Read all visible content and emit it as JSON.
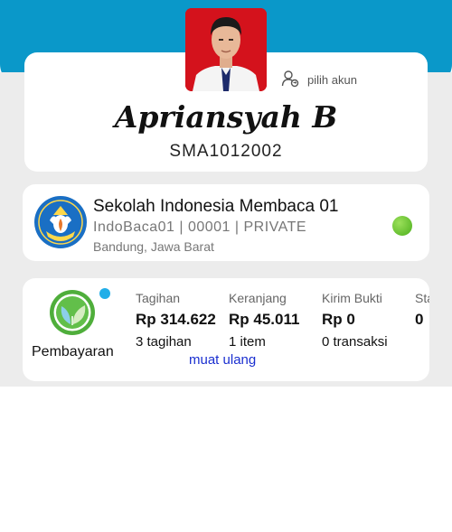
{
  "profile": {
    "name": "Apriansyah B",
    "student_code": "SMA1012002",
    "switch_account_label": "pilih akun"
  },
  "school": {
    "name": "Sekolah Indonesia Membaca 01",
    "meta": "IndoBaca01  |  00001  |  PRIVATE",
    "location": "Bandung, Jawa Barat",
    "status_color": "#5cc22a"
  },
  "payment": {
    "label": "Pembayaran",
    "reload_label": "muat ulang",
    "columns": [
      {
        "label": "Tagihan",
        "value": "Rp 314.622",
        "sub": "3 tagihan"
      },
      {
        "label": "Keranjang",
        "value": "Rp 45.011",
        "sub": "1 item"
      },
      {
        "label": "Kirim Bukti",
        "value": "Rp 0",
        "sub": "0 transaksi"
      },
      {
        "label": "Sta",
        "value": "0",
        "sub": ""
      }
    ]
  },
  "colors": {
    "header": "#0a98c9",
    "background": "#ececec",
    "link": "#1a2fd0"
  }
}
